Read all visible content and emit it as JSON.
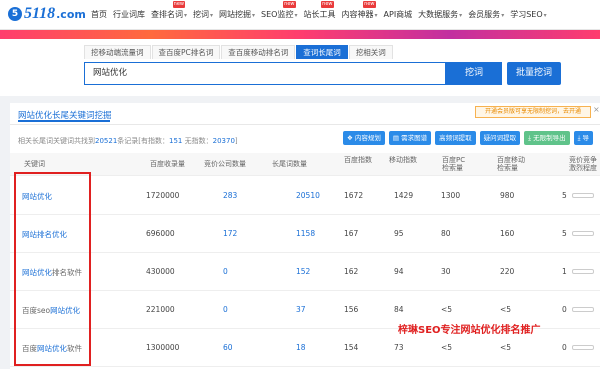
{
  "logo": {
    "mark": "5",
    "text": "5118",
    "domain": ".com"
  },
  "nav": [
    {
      "label": "首页",
      "caret": false,
      "badge": ""
    },
    {
      "label": "行业词库",
      "caret": false,
      "badge": ""
    },
    {
      "label": "查排名词",
      "caret": true,
      "badge": "new"
    },
    {
      "label": "挖词",
      "caret": true,
      "badge": ""
    },
    {
      "label": "网站挖掘",
      "caret": true,
      "badge": ""
    },
    {
      "label": "SEO监控",
      "caret": true,
      "badge": "new"
    },
    {
      "label": "站长工具",
      "caret": false,
      "badge": "new"
    },
    {
      "label": "内容神器",
      "caret": true,
      "badge": "new"
    },
    {
      "label": "API商城",
      "caret": false,
      "badge": ""
    },
    {
      "label": "大数据服务",
      "caret": true,
      "badge": ""
    },
    {
      "label": "会员服务",
      "caret": true,
      "badge": ""
    },
    {
      "label": "学习SEO",
      "caret": true,
      "badge": ""
    }
  ],
  "tabs": [
    "挖移动端流量词",
    "查百度PC排名词",
    "查百度移动排名词",
    "查词长尾词",
    "挖相关词"
  ],
  "active_tab": 3,
  "search": {
    "value": "网站优化",
    "button": "挖词",
    "batch_button": "批量挖词"
  },
  "section": {
    "title": "网站优化长尾关键词挖掘",
    "upgrade": "开通会员版可享无限制挖词，去开通",
    "close": "×"
  },
  "summary": {
    "prefix": "相关长尾词关键词共找到",
    "count": "20521",
    "mid": "条记录[有指数：",
    "indexed": "151",
    "mid2": " 无指数：",
    "noindex": "20370",
    "suffix": "]"
  },
  "actions": [
    "内容规划",
    "需求图谱",
    "高频词提取",
    "疑问词提取",
    "无限制导出",
    "导"
  ],
  "columns": [
    "关键词",
    "百度收录量",
    "竞价公司数量",
    "长尾词数量",
    "百度指数",
    "移动指数",
    "百度PC检索量",
    "百度移动检索量",
    "竞价竞争激烈程度"
  ],
  "rows": [
    {
      "kw_parts": [
        {
          "t": "网站优化",
          "c": "b"
        }
      ],
      "indexed": "1720000",
      "bid": "283",
      "longtail": "20510",
      "bdi": "1672",
      "mi": "1429",
      "pc": "1300",
      "mob": "980",
      "comp": "5"
    },
    {
      "kw_parts": [
        {
          "t": "网站排名优化",
          "c": "b"
        }
      ],
      "indexed": "696000",
      "bid": "172",
      "longtail": "1158",
      "bdi": "167",
      "mi": "95",
      "pc": "80",
      "mob": "160",
      "comp": "5"
    },
    {
      "kw_parts": [
        {
          "t": "网站优化",
          "c": "b"
        },
        {
          "t": "排名软件",
          "c": "g"
        }
      ],
      "indexed": "430000",
      "bid": "0",
      "longtail": "152",
      "bdi": "162",
      "mi": "94",
      "pc": "30",
      "mob": "220",
      "comp": "1"
    },
    {
      "kw_parts": [
        {
          "t": "百度seo",
          "c": "g"
        },
        {
          "t": "网站优化",
          "c": "b"
        }
      ],
      "indexed": "221000",
      "bid": "0",
      "longtail": "37",
      "bdi": "156",
      "mi": "84",
      "pc": "<5",
      "mob": "<5",
      "comp": "0"
    },
    {
      "kw_parts": [
        {
          "t": "百度",
          "c": "g"
        },
        {
          "t": "网站优化",
          "c": "b"
        },
        {
          "t": "软件",
          "c": "g"
        }
      ],
      "indexed": "1300000",
      "bid": "60",
      "longtail": "18",
      "bdi": "154",
      "mi": "73",
      "pc": "<5",
      "mob": "<5",
      "comp": "0"
    }
  ],
  "watermark": "梓琳SEO专注网站优化排名推广"
}
